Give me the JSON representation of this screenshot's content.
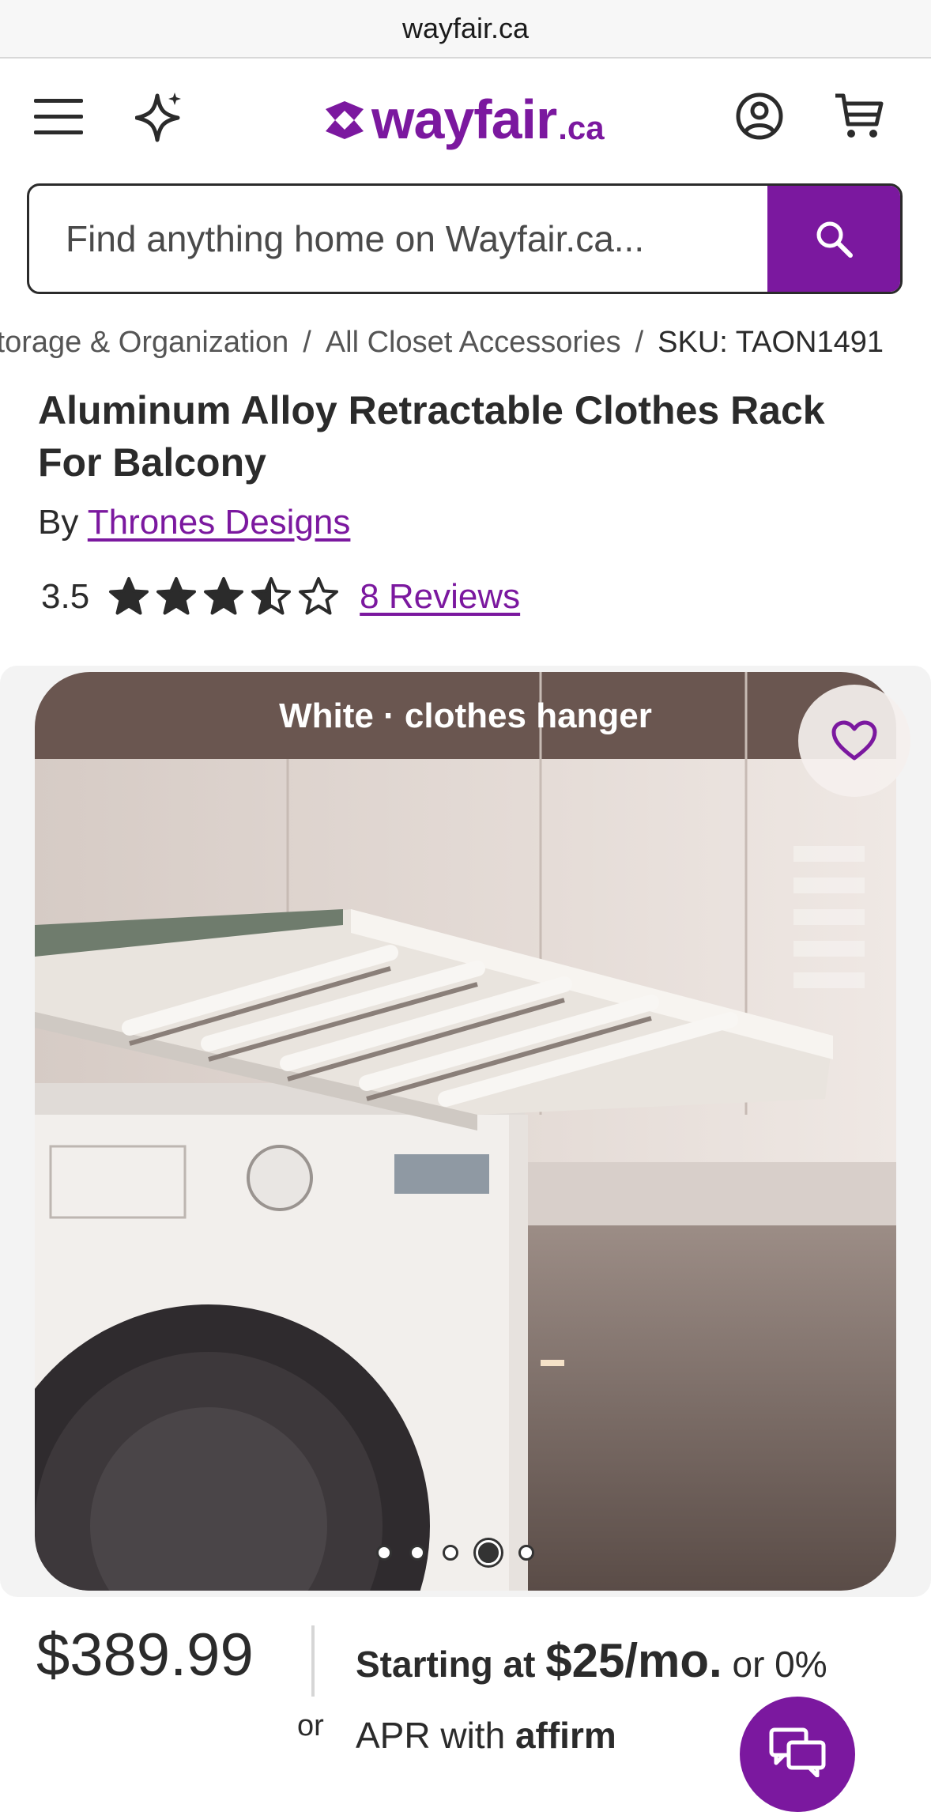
{
  "browser": {
    "url": "wayfair.ca"
  },
  "header": {
    "logo_word": "wayfair",
    "logo_suffix": ".ca",
    "brand_color": "#7b189f",
    "icons": [
      "menu-icon",
      "sparkle-icon",
      "account-icon",
      "cart-icon"
    ]
  },
  "search": {
    "placeholder": "Find anything home on Wayfair.ca...",
    "button_icon": "search-icon"
  },
  "breadcrumb": {
    "items": [
      "Storage & Organization",
      "All Closet Accessories"
    ],
    "current": "SKU: TAON1491",
    "separator": "/"
  },
  "product": {
    "title": "Aluminum Alloy Retractable Clothes Rack For Balcony",
    "by_label": "By",
    "brand": "Thrones Designs",
    "rating": "3.5",
    "rating_value": 3.5,
    "rating_max": 5,
    "reviews_label": "8 Reviews"
  },
  "gallery": {
    "image_caption": "White · clothes hanger",
    "dot_count": 5,
    "active_dot": 4,
    "favorite_icon": "heart-icon"
  },
  "pricing": {
    "price": "$389.99",
    "or_label": "or",
    "starting_at": "Starting at",
    "monthly": "$25/mo.",
    "apr_text": "or 0%",
    "apr_with": "APR with",
    "affirm": "affirm"
  },
  "chat": {
    "icon": "chat-icon"
  }
}
